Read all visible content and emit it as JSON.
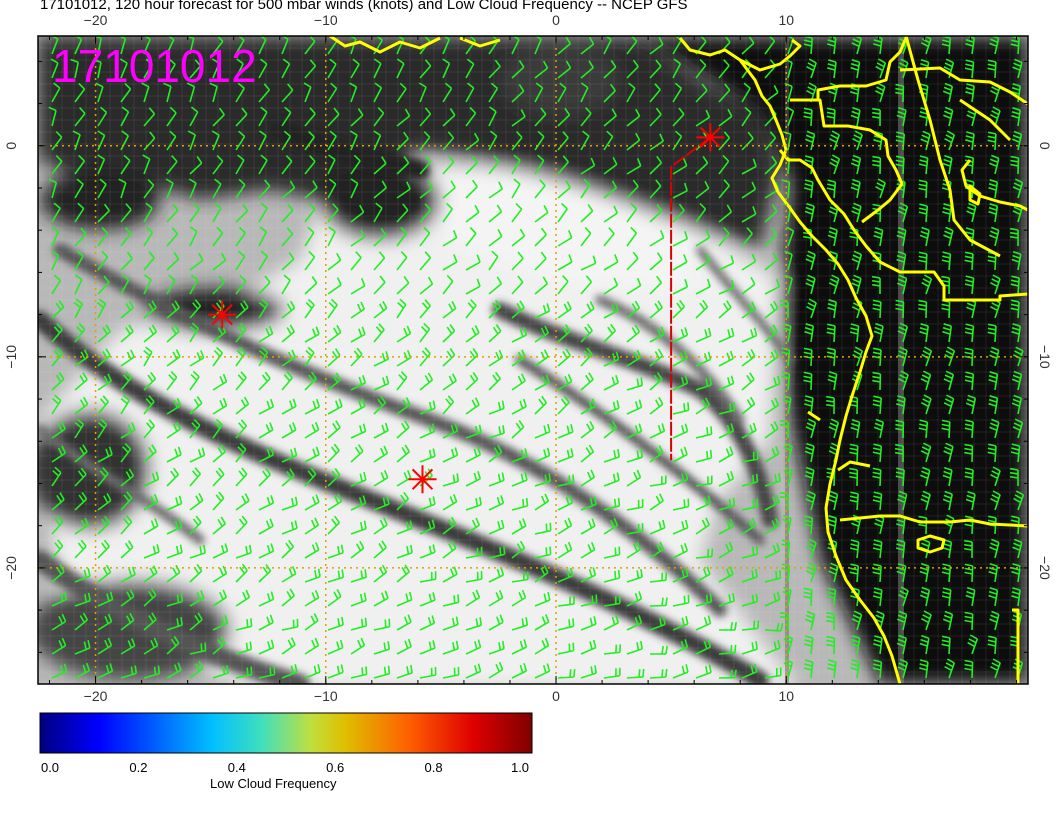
{
  "title": "17101012, 120 hour forecast for 500 mbar winds (knots) and Low Cloud Frequency -- NCEP GFS",
  "stamp": "17101012",
  "colors": {
    "stamp": "#ff00ff",
    "coast": "#ffff00",
    "barb": "#22ee22",
    "grid": "#e0a000",
    "marker": "#ff0000",
    "track": "#dd0000"
  },
  "chart_data": {
    "type": "heatmap",
    "title": "17101012, 120 hour forecast for 500 mbar winds (knots) and Low Cloud Frequency -- NCEP GFS",
    "x_ticks": [
      "−20",
      "−10",
      "0",
      "10"
    ],
    "y_ticks": [
      "0",
      "−10",
      "−20"
    ],
    "x_tick_values": [
      -20,
      -10,
      0,
      10
    ],
    "y_tick_values": [
      0,
      -10,
      -20
    ],
    "xlim": [
      -22.5,
      20.5
    ],
    "ylim": [
      -25.5,
      5.2
    ],
    "markers": [
      {
        "lon": 6.7,
        "lat": 0.4
      },
      {
        "lon": -14.5,
        "lat": -8.0
      },
      {
        "lon": -5.8,
        "lat": -15.8
      }
    ],
    "track": [
      {
        "lon": 6.7,
        "lat": 0.4
      },
      {
        "lon": 5.0,
        "lat": -1.0
      },
      {
        "lon": 5.0,
        "lat": -14.9
      }
    ],
    "colorbar": {
      "label": "Low Cloud Frequency",
      "ticks": [
        "0.0",
        "0.2",
        "0.4",
        "0.6",
        "0.8",
        "1.0"
      ],
      "tick_values": [
        0,
        0.2,
        0.4,
        0.6,
        0.8,
        1.0
      ],
      "range": [
        0,
        1
      ],
      "stops": [
        "#00007f",
        "#0000ff",
        "#00bfff",
        "#3fdfbf",
        "#bfdf3f",
        "#dfbf00",
        "#ff5f00",
        "#df0000",
        "#7f0000"
      ]
    }
  }
}
